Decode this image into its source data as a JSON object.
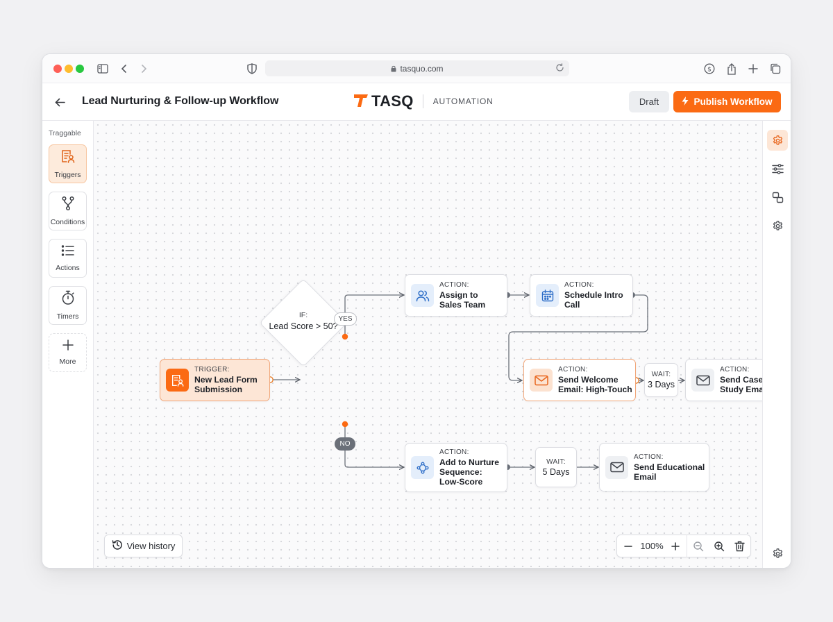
{
  "browser": {
    "url": "tasquo.com"
  },
  "header": {
    "title": "Lead Nurturing & Follow-up Workflow",
    "brand_name": "TASQ",
    "brand_tag": "AUTOMATION",
    "draft_label": "Draft",
    "publish_label": "Publish Workflow",
    "accent_color": "#fb6a13"
  },
  "sidebar": {
    "header": "Traggable",
    "tools": [
      {
        "label": "Triggers",
        "icon": "trigger-form-icon",
        "active": true
      },
      {
        "label": "Conditions",
        "icon": "branch-icon",
        "active": false
      },
      {
        "label": "Actions",
        "icon": "list-icon",
        "active": false
      },
      {
        "label": "Timers",
        "icon": "stopwatch-icon",
        "active": false
      },
      {
        "label": "More",
        "icon": "plus-icon",
        "active": false
      }
    ]
  },
  "canvas": {
    "trigger": {
      "kind": "TRIGGER:",
      "title": "New Lead Form Submission",
      "icon": "form-user-icon"
    },
    "condition": {
      "kind": "IF:",
      "title": "Lead Score > 50?",
      "yes_label": "YES",
      "no_label": "NO"
    },
    "actions": [
      {
        "id": "assign",
        "kind": "ACTION:",
        "title": "Assign to Sales Team",
        "icon": "users-icon"
      },
      {
        "id": "schedule",
        "kind": "ACTION:",
        "title": "Schedule Intro Call",
        "icon": "calendar-icon"
      },
      {
        "id": "welcome",
        "kind": "ACTION:",
        "title": "Send Welcome Email: High-Touch",
        "icon": "mail-icon"
      },
      {
        "id": "casestudy",
        "kind": "ACTION:",
        "title": "Send Case Study Email",
        "icon": "mail-icon"
      },
      {
        "id": "nurture",
        "kind": "ACTION:",
        "title": "Add to Nurture Sequence: Low-Score",
        "icon": "sequence-icon"
      },
      {
        "id": "educational",
        "kind": "ACTION:",
        "title": "Send Educational Email",
        "icon": "mail-icon"
      }
    ],
    "waits": [
      {
        "id": "wait3",
        "kind": "WAIT:",
        "value": "3 Days"
      },
      {
        "id": "wait5",
        "kind": "WAIT:",
        "value": "5 Days"
      }
    ]
  },
  "footer": {
    "history_label": "View history",
    "zoom_value": "100%"
  }
}
